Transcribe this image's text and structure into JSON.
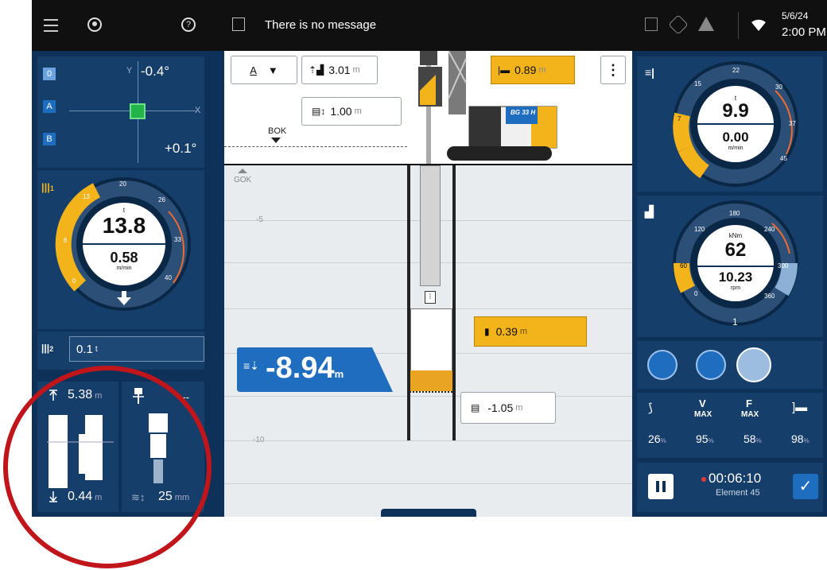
{
  "status_bar": {
    "message": "There is no message",
    "date": "5/6/24",
    "time": "2:00 PM"
  },
  "inclination": {
    "y_value": "-0.4°",
    "x_value": "+0.1°",
    "axis_x": "X",
    "axis_y": "Y",
    "buttons": [
      "0",
      "A",
      "B"
    ]
  },
  "winch1": {
    "load_value": "13.8",
    "load_unit": "t",
    "speed_value": "0.58",
    "speed_unit": "m/min",
    "ticks": [
      "0",
      "6",
      "13",
      "20",
      "26",
      "33",
      "40"
    ],
    "sub": "1"
  },
  "winch2": {
    "value": "0.1",
    "unit": "t",
    "sub": "2"
  },
  "left_bottom": {
    "top_value": "5.38",
    "top_unit": "m",
    "bottom_value": "0.44",
    "bottom_unit": "m",
    "right_top": "---",
    "right_bottom_value": "25",
    "right_bottom_unit": "mm"
  },
  "center_view": {
    "top_value1": "3.01",
    "top_value1_unit": "m",
    "top_value2": "1.00",
    "top_value2_unit": "m",
    "yellow_top": "0.89",
    "yellow_top_unit": "m",
    "bok_label": "BOK",
    "gok_label": "GOK",
    "axis_labels": [
      "-5",
      "-10"
    ],
    "depth_value": "-8.94",
    "depth_unit": "m",
    "yellow_mid": "0.39",
    "yellow_mid_unit": "m",
    "white_mid": "-1.05",
    "white_mid_unit": "m",
    "machine_label": "BG 33 H"
  },
  "right_gauge1": {
    "value": "9.9",
    "unit": "t",
    "speed": "0.00",
    "speed_unit": "m/min",
    "ticks": [
      "7",
      "15",
      "22",
      "30",
      "37",
      "45"
    ]
  },
  "right_gauge2": {
    "value": "62",
    "unit": "kNm",
    "speed": "10.23",
    "speed_unit": "rpm",
    "ticks": [
      "0",
      "60",
      "120",
      "180",
      "240",
      "300",
      "360"
    ],
    "sub": "1"
  },
  "stats": {
    "labels": [
      "",
      "V",
      "F",
      ""
    ],
    "max_label": "MAX",
    "values": [
      "26",
      "95",
      "58",
      "98"
    ],
    "unit": "%"
  },
  "timer": {
    "time": "00:06:10",
    "element": "Element 45"
  },
  "colors": {
    "navy": "#0d3158",
    "panel": "#163e6a",
    "accent_yellow": "#f2b31b",
    "accent_blue": "#1f6dbf",
    "annotation_red": "#c0151b"
  }
}
